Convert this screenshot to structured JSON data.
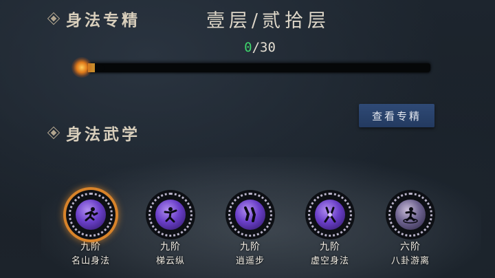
{
  "header": {
    "section_title": "身法专精",
    "level_text": "壹层/贰拾层",
    "progress_current": "0",
    "progress_sep_total": "/30",
    "progress_fraction": 0.02
  },
  "view_button": {
    "label": "查看专精"
  },
  "skills_section": {
    "title": "身法武学"
  },
  "skills": [
    {
      "tier": "九阶",
      "name": "名山身法",
      "icon": "running-figure-icon",
      "selected": true
    },
    {
      "tier": "九阶",
      "name": "梯云纵",
      "icon": "leaping-figure-icon",
      "selected": false
    },
    {
      "tier": "九阶",
      "name": "逍遥步",
      "icon": "footsteps-icon",
      "selected": false
    },
    {
      "tier": "九阶",
      "name": "虚空身法",
      "icon": "void-step-icon",
      "selected": false
    },
    {
      "tier": "六阶",
      "name": "八卦游离",
      "icon": "bagua-figure-icon",
      "selected": false
    }
  ],
  "colors": {
    "accent_green": "#3ed36b",
    "button_blue": "#2f4a76",
    "selected_ring": "#d8832a",
    "skill_purple": "#6a3fc8"
  }
}
